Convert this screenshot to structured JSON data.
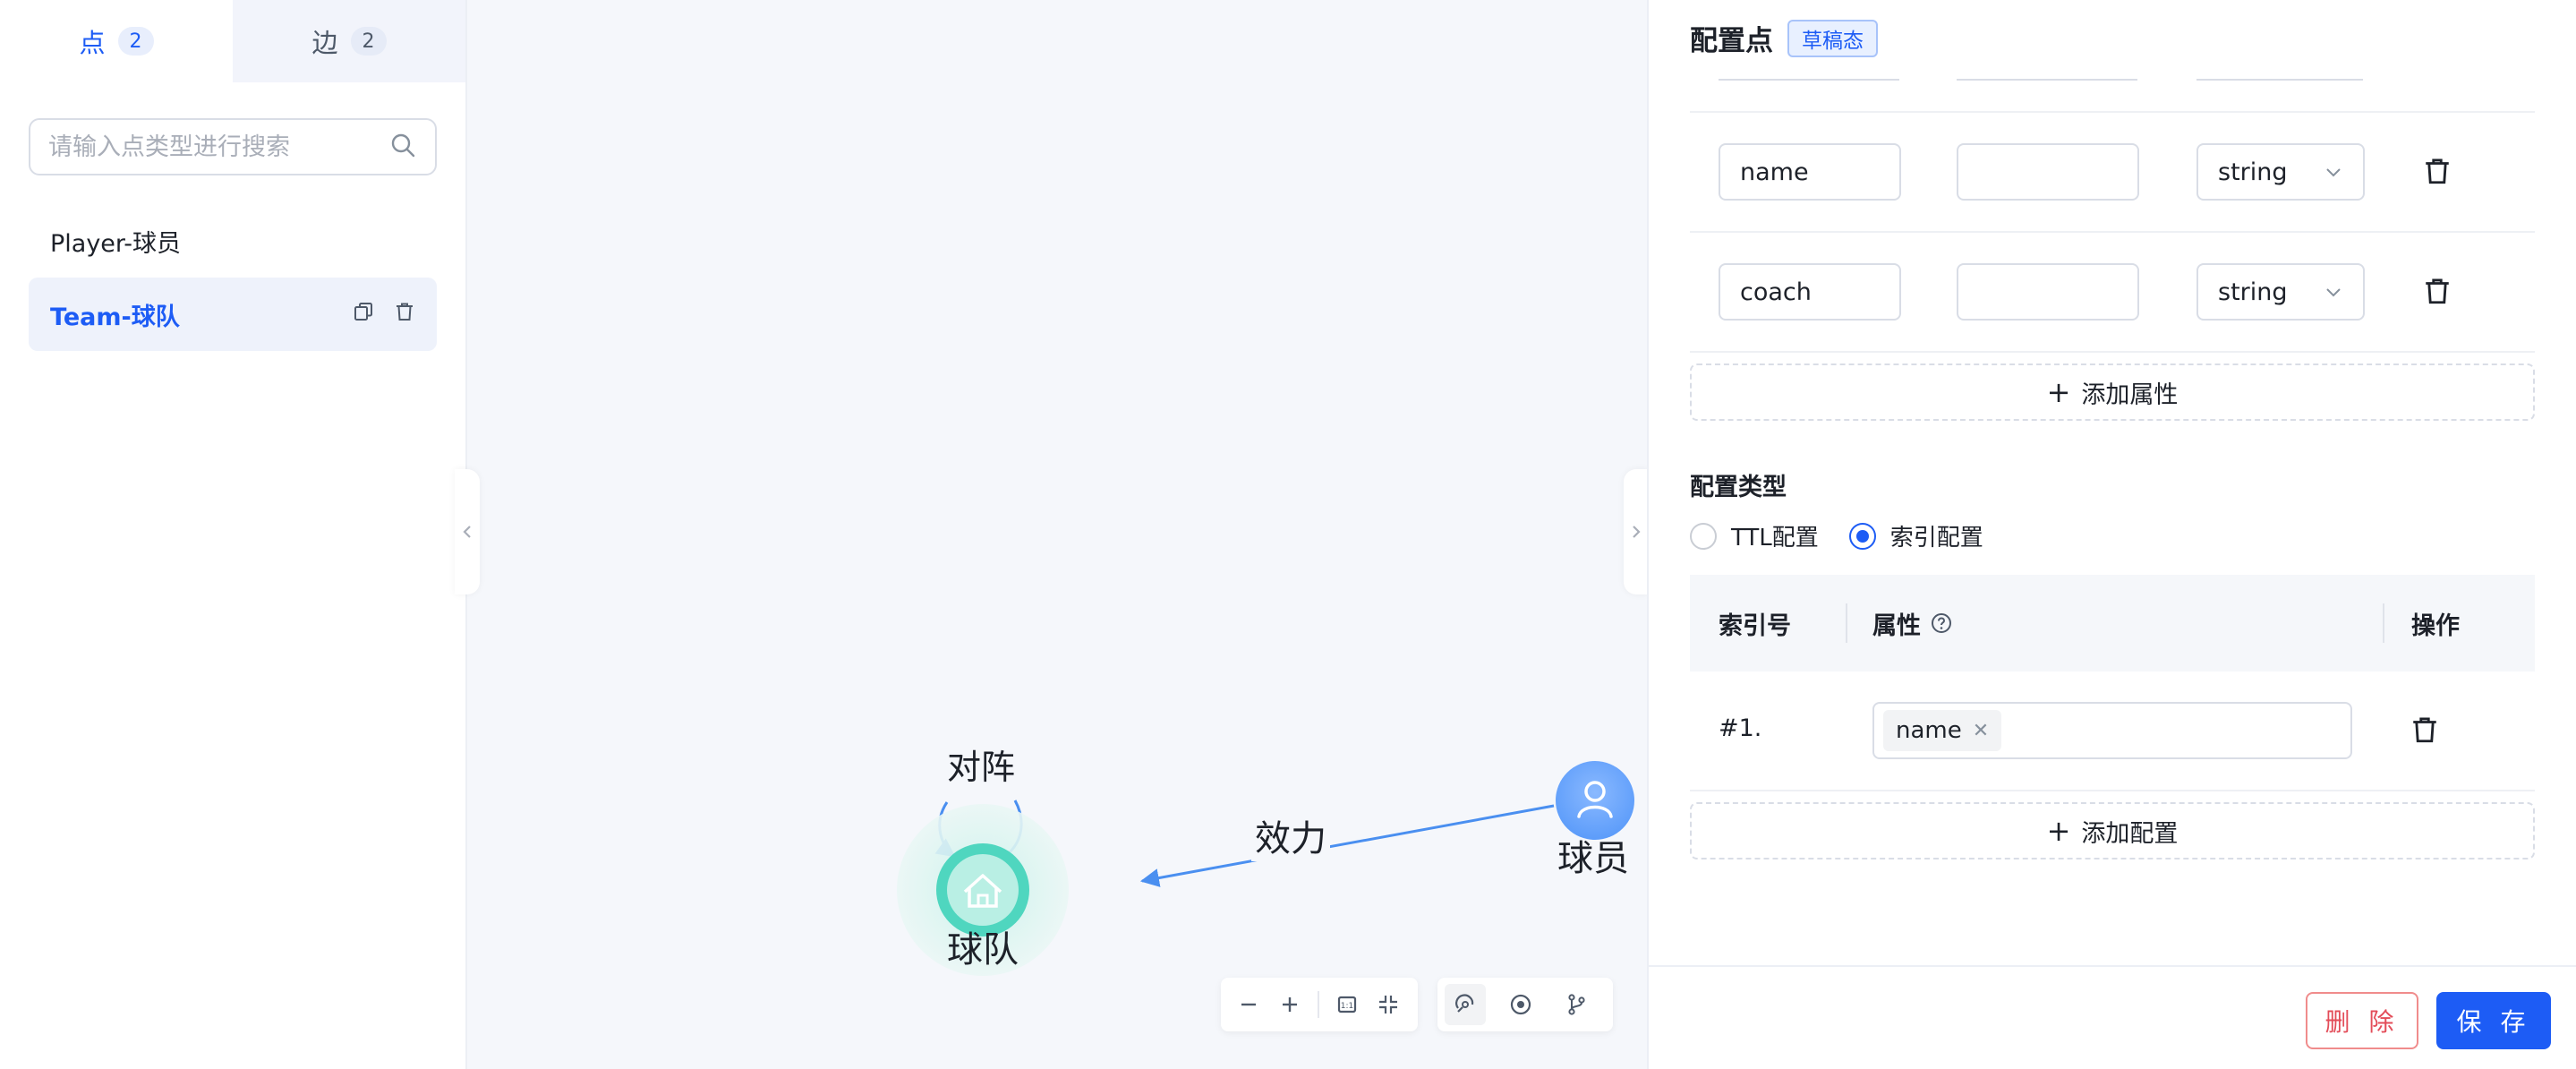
{
  "left_panel": {
    "tabs": [
      {
        "label": "点",
        "count": "2",
        "active": true
      },
      {
        "label": "边",
        "count": "2",
        "active": false
      }
    ],
    "search": {
      "placeholder": "请输入点类型进行搜索"
    },
    "types": [
      {
        "label": "Player-球员",
        "selected": false
      },
      {
        "label": "Team-球队",
        "selected": true
      }
    ]
  },
  "graph": {
    "nodes": [
      {
        "label": "球队",
        "icon": "home-icon",
        "color": "#4fd6bf"
      },
      {
        "label": "球员",
        "icon": "user-icon",
        "color": "#6aa6ff"
      }
    ],
    "edges": [
      {
        "label": "对阵",
        "from": "球队",
        "to": "球队"
      },
      {
        "label": "效力",
        "from": "球员",
        "to": "球队"
      }
    ],
    "toolbar": {
      "items": [
        "zoom-out-icon",
        "zoom-in-icon",
        "fit-view-icon",
        "collapse-icon",
        "layout-icon",
        "focus-icon",
        "branch-icon"
      ]
    }
  },
  "right_panel": {
    "title": "配置点",
    "status_badge": "草稿态",
    "properties": [
      {
        "name": "name",
        "default": "",
        "type": "string"
      },
      {
        "name": "coach",
        "default": "",
        "type": "string"
      }
    ],
    "add_property": "添加属性",
    "config_type_label": "配置类型",
    "config_options": [
      {
        "label": "TTL配置",
        "checked": false
      },
      {
        "label": "索引配置",
        "checked": true
      }
    ],
    "index_table": {
      "headers": {
        "index_no": "索引号",
        "property": "属性",
        "action": "操作"
      },
      "rows": [
        {
          "num": "#1.",
          "tags": [
            "name"
          ]
        }
      ]
    },
    "add_config": "添加配置",
    "buttons": {
      "delete": "删 除",
      "save": "保 存"
    }
  },
  "colors": {
    "accent": "#1d5cf5",
    "danger": "#e34d59",
    "team_node": "#4fd6bf",
    "player_node": "#6aa6ff",
    "edge": "#4a8ff0"
  }
}
